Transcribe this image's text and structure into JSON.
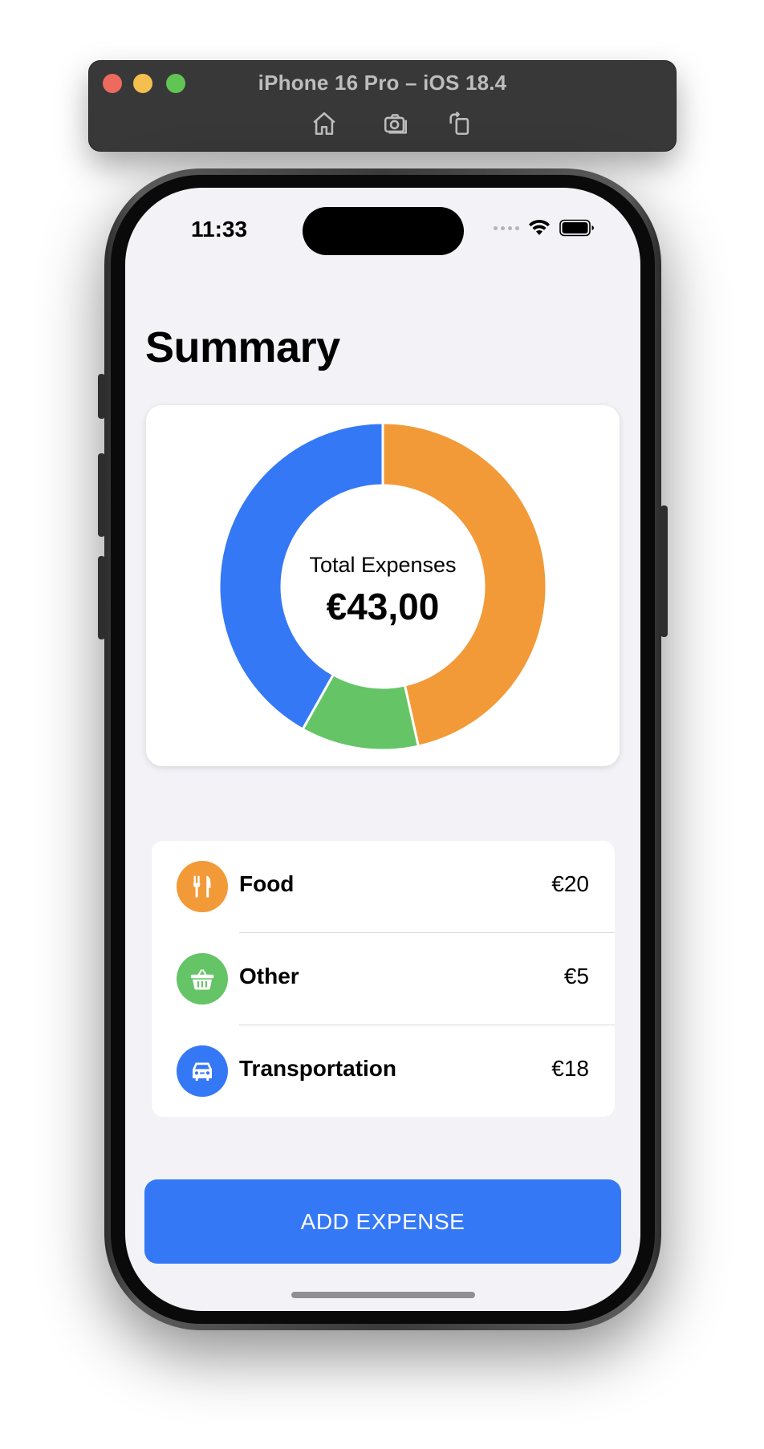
{
  "simulator": {
    "title": "iPhone 16 Pro – iOS 18.4",
    "tools": [
      "home-icon",
      "screenshot-icon",
      "rotate-icon"
    ]
  },
  "status_bar": {
    "time": "11:33"
  },
  "page": {
    "title": "Summary"
  },
  "summary_chart": {
    "center_label": "Total Expenses",
    "center_value": "€43,00"
  },
  "chart_data": {
    "type": "pie",
    "style": "donut",
    "categories": [
      "Food",
      "Other",
      "Transportation"
    ],
    "values": [
      20,
      5,
      18
    ],
    "colors": [
      "#f29a38",
      "#64c466",
      "#3478f6"
    ],
    "total": 43
  },
  "categories": [
    {
      "name": "Food",
      "amount": "€20",
      "icon": "fork-knife-icon",
      "color": "#f29a38"
    },
    {
      "name": "Other",
      "amount": "€5",
      "icon": "basket-icon",
      "color": "#64c466"
    },
    {
      "name": "Transportation",
      "amount": "€18",
      "icon": "car-icon",
      "color": "#3478f6"
    }
  ],
  "actions": {
    "add_expense_label": "ADD EXPENSE"
  }
}
